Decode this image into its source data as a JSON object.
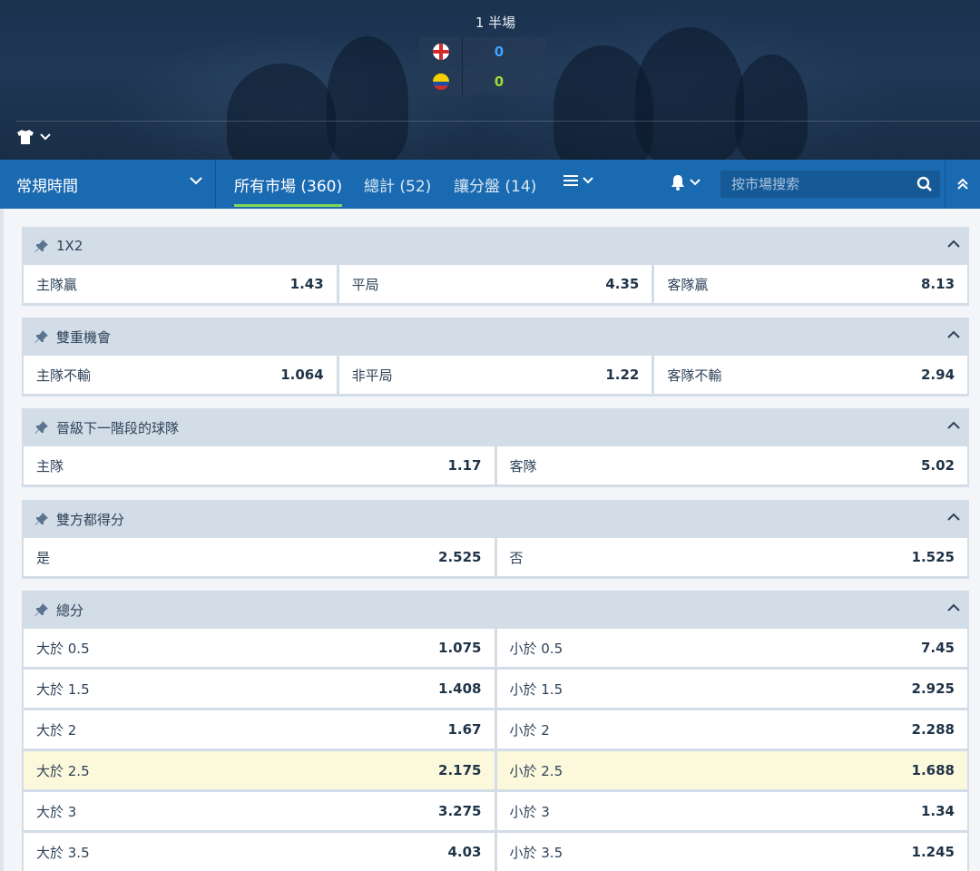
{
  "match": {
    "period": "1 半場",
    "home_score": "0",
    "away_score": "0",
    "home_score_color": "#3ea2ff",
    "away_score_color": "#9ddb3a",
    "home_flag": "england-flag-icon",
    "away_flag": "colombia-flag-icon"
  },
  "toolbar": {
    "period_select": "常規時間",
    "tabs": [
      {
        "label": "所有市場 (360)"
      },
      {
        "label": "總計 (52)"
      },
      {
        "label": "讓分盤 (14)"
      }
    ],
    "search_placeholder": "按市場搜索",
    "accent_color": "#1a6ab1",
    "active_tab_underline": "#7ed957"
  },
  "markets": [
    {
      "title": "1X2",
      "rows": [
        [
          {
            "label": "主隊贏",
            "odds": "1.43"
          },
          {
            "label": "平局",
            "odds": "4.35"
          },
          {
            "label": "客隊贏",
            "odds": "8.13"
          }
        ]
      ]
    },
    {
      "title": "雙重機會",
      "rows": [
        [
          {
            "label": "主隊不輸",
            "odds": "1.064"
          },
          {
            "label": "非平局",
            "odds": "1.22"
          },
          {
            "label": "客隊不輸",
            "odds": "2.94"
          }
        ]
      ]
    },
    {
      "title": "晉級下一階段的球隊",
      "rows": [
        [
          {
            "label": "主隊",
            "odds": "1.17"
          },
          {
            "label": "客隊",
            "odds": "5.02"
          }
        ]
      ]
    },
    {
      "title": "雙方都得分",
      "rows": [
        [
          {
            "label": "是",
            "odds": "2.525"
          },
          {
            "label": "否",
            "odds": "1.525"
          }
        ]
      ]
    },
    {
      "title": "總分",
      "rows": [
        [
          {
            "label": "大於 0.5",
            "odds": "1.075"
          },
          {
            "label": "小於 0.5",
            "odds": "7.45"
          }
        ],
        [
          {
            "label": "大於 1.5",
            "odds": "1.408"
          },
          {
            "label": "小於 1.5",
            "odds": "2.925"
          }
        ],
        [
          {
            "label": "大於 2",
            "odds": "1.67"
          },
          {
            "label": "小於 2",
            "odds": "2.288"
          }
        ],
        [
          {
            "label": "大於 2.5",
            "odds": "2.175"
          },
          {
            "label": "小於 2.5",
            "odds": "1.688"
          }
        ],
        [
          {
            "label": "大於 3",
            "odds": "3.275"
          },
          {
            "label": "小於 3",
            "odds": "1.34"
          }
        ],
        [
          {
            "label": "大於 3.5",
            "odds": "4.03"
          },
          {
            "label": "小於 3.5",
            "odds": "1.245"
          }
        ]
      ]
    }
  ],
  "highlight_color": "#fcf8dc"
}
